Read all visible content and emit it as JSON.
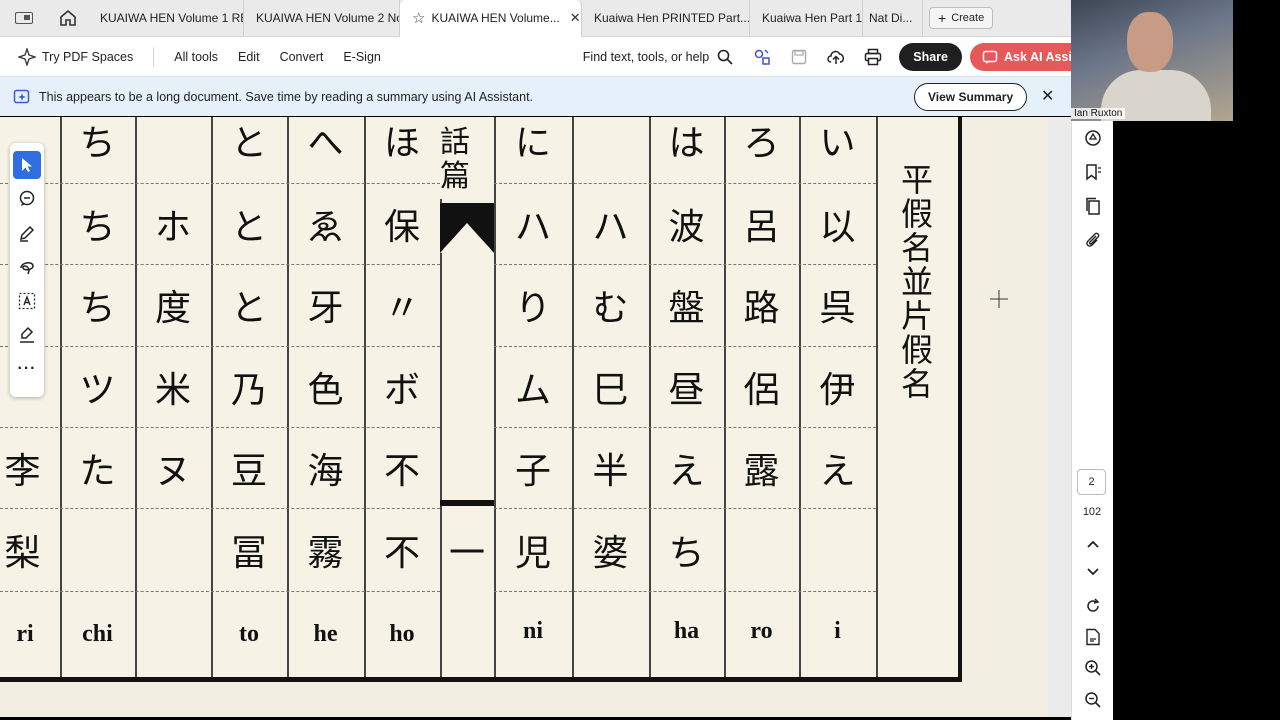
{
  "tabs": [
    {
      "label": "KUAIWA HEN Volume 1 RE..."
    },
    {
      "label": "KUAIWA HEN Volume 2 No..."
    },
    {
      "label": "KUAIWA HEN Volume..."
    },
    {
      "label": "Kuaiwa Hen PRINTED Part..."
    },
    {
      "label": "Kuaiwa Hen Part 1"
    },
    {
      "label": "Nat Di..."
    }
  ],
  "create_label": "Create",
  "toolbar": {
    "spaces": "Try PDF Spaces",
    "all_tools": "All tools",
    "edit": "Edit",
    "convert": "Convert",
    "esign": "E-Sign",
    "find": "Find text, tools, or help",
    "share": "Share",
    "ai": "Ask AI Assistant"
  },
  "banner": {
    "text": "This appears to be a long document. Save time by reading a summary using AI Assistant.",
    "button": "View Summary"
  },
  "document": {
    "heading_chars": "話篇",
    "row0": [
      "ち",
      "",
      "と",
      "へ",
      "ほ",
      "に",
      "",
      "は",
      "ろ",
      "い"
    ],
    "row1": [
      "ち",
      "ホ",
      "と",
      "ゑ",
      "保",
      "ハ",
      "ハ",
      "波",
      "呂",
      "以"
    ],
    "row2": [
      "ち",
      "度",
      "と",
      "牙",
      "〃",
      "り",
      "む",
      "盤",
      "路",
      "呉"
    ],
    "row3": [
      "ツ",
      "米",
      "乃",
      "色",
      "ボ",
      "ム",
      "巳",
      "昼",
      "侶",
      "伊"
    ],
    "row4": [
      "李",
      "た",
      "ヌ",
      "豆",
      "海",
      "不",
      "子",
      "半",
      "え",
      "露",
      "え"
    ],
    "row5": [
      "梨",
      "",
      "",
      "冨",
      "霧",
      "不",
      "一",
      "児",
      "婆",
      "ち"
    ],
    "romaji": [
      "ri",
      "chi",
      "to",
      "he",
      "ho",
      "ni",
      "ha",
      "ro",
      "i"
    ],
    "side_column": "平假名並片假名"
  },
  "page_indicator": {
    "current": "2",
    "total": "102"
  },
  "webcam": {
    "name": "Ian Ruxton"
  },
  "colors": {
    "accent": "#2f6de1",
    "ai_button": "#e8585a",
    "banner": "#e5f0fb",
    "paper": "#f6f3e6"
  }
}
